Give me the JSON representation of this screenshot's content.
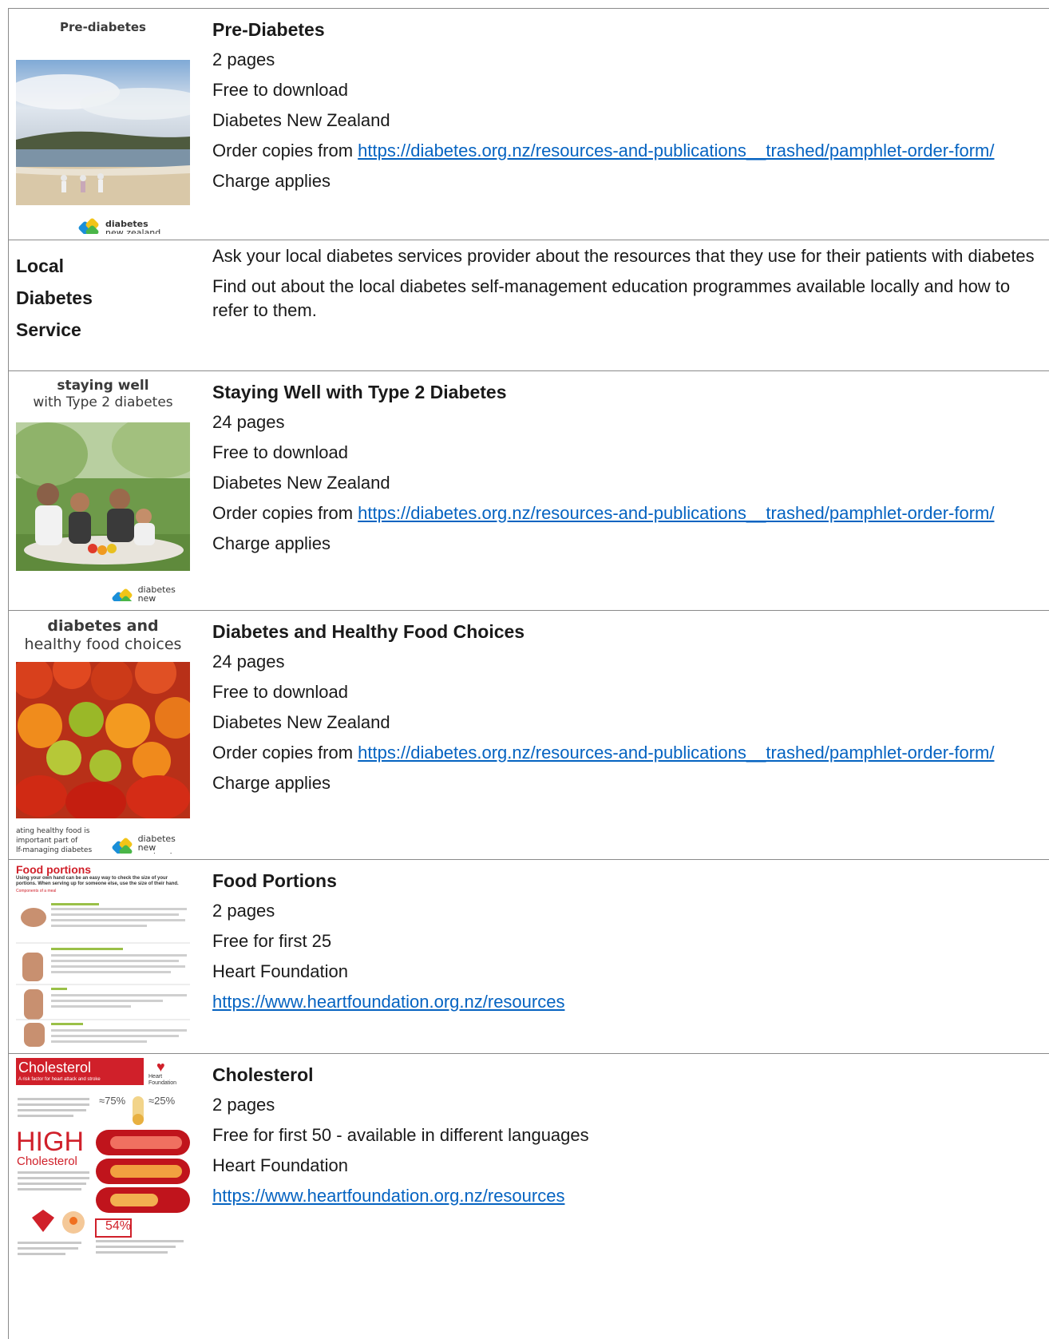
{
  "rows": [
    {
      "image_caption": "Pre-diabetes",
      "logo_line1": "diabetes",
      "logo_line2": "new zealand",
      "title": "Pre-Diabetes",
      "pages": "2 pages",
      "cost": "Free to download",
      "publisher": "Diabetes New Zealand",
      "order_prefix": "Order copies from ",
      "order_link": "https://diabetes.org.nz/resources-and-publications__trashed/pamphlet-order-form/",
      "charge": "Charge applies"
    },
    {
      "label_line1": "Local",
      "label_line2": "Diabetes",
      "label_line3": "Service",
      "para1": "Ask your local diabetes services provider about the resources that they use for their patients with diabetes",
      "para2": "Find out about the local diabetes self-management education programmes available locally and how to refer to them."
    },
    {
      "image_caption_1": "staying well",
      "image_caption_2": "with Type 2 diabetes",
      "logo_line1": "diabetes",
      "logo_line2": "new zealand",
      "title": "Staying Well with Type 2 Diabetes",
      "pages": "24 pages",
      "cost": "Free to download",
      "publisher": "Diabetes New Zealand",
      "order_prefix": "Order copies from ",
      "order_link": "https://diabetes.org.nz/resources-and-publications__trashed/pamphlet-order-form/",
      "charge": "Charge applies"
    },
    {
      "image_caption_1": "diabetes and",
      "image_caption_2": "healthy food choices",
      "side_note_1": "ating healthy food is",
      "side_note_2": "important part of",
      "side_note_3": "lf-managing diabetes",
      "logo_line1": "diabetes",
      "logo_line2": "new zealand",
      "title": "Diabetes and Healthy Food Choices",
      "pages": "24 pages",
      "cost": "Free to download",
      "publisher": "Diabetes New Zealand",
      "order_prefix": "Order copies from ",
      "order_link": "https://diabetes.org.nz/resources-and-publications__trashed/pamphlet-order-form/",
      "charge": "Charge applies"
    },
    {
      "image_caption": "Food portions",
      "image_sub": "Using your own hand can be an easy way to check the size of your portions. When serving up for someone else, use the size of their hand.",
      "image_section": "Components of a meal",
      "title": "Food Portions",
      "pages": "2 pages",
      "cost": "Free for first 25",
      "publisher": "Heart Foundation",
      "link": "https://www.heartfoundation.org.nz/resources"
    },
    {
      "image_caption": "Cholesterol",
      "image_sub": "A risk factor for heart attack and stroke",
      "image_logo": "Heart Foundation",
      "image_big": "HIGH",
      "image_big_sub": "Cholesterol",
      "image_pct1": "≈75%",
      "image_pct2": "≈25%",
      "image_pct3": "54%",
      "title": "Cholesterol",
      "pages": "2 pages",
      "cost": "Free for first 50 -  available in different languages",
      "publisher": "Heart Foundation",
      "link": "https://www.heartfoundation.org.nz/resources"
    }
  ],
  "colors": {
    "link": "#0563c1",
    "border": "#8a8a8a",
    "heart_red": "#d0202a",
    "logo_blue": "#1a8fd8",
    "logo_yellow": "#f2c418",
    "logo_green": "#4ab648"
  }
}
